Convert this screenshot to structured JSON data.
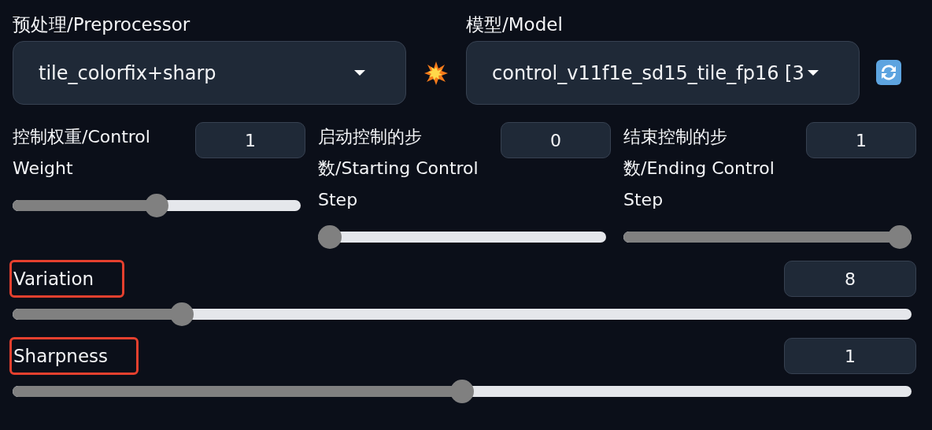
{
  "preprocessor": {
    "label": "预处理/Preprocessor",
    "value": "tile_colorfix+sharp"
  },
  "model": {
    "label": "模型/Model",
    "value": "control_v11f1e_sd15_tile_fp16 [3"
  },
  "step_sliders": [
    {
      "label": "控制权重/Control Weight",
      "value": "1",
      "level": 0.5
    },
    {
      "label": "启动控制的步数/Starting Control Step",
      "value": "0",
      "level": 0
    },
    {
      "label": "结束控制的步数/Ending Control Step",
      "value": "1",
      "level": 1
    }
  ],
  "wide_sliders": [
    {
      "label": "Variation",
      "value": "8",
      "level": 0.18,
      "highlighted": true
    },
    {
      "label": "Sharpness",
      "value": "1",
      "level": 0.5,
      "highlighted": true
    }
  ]
}
